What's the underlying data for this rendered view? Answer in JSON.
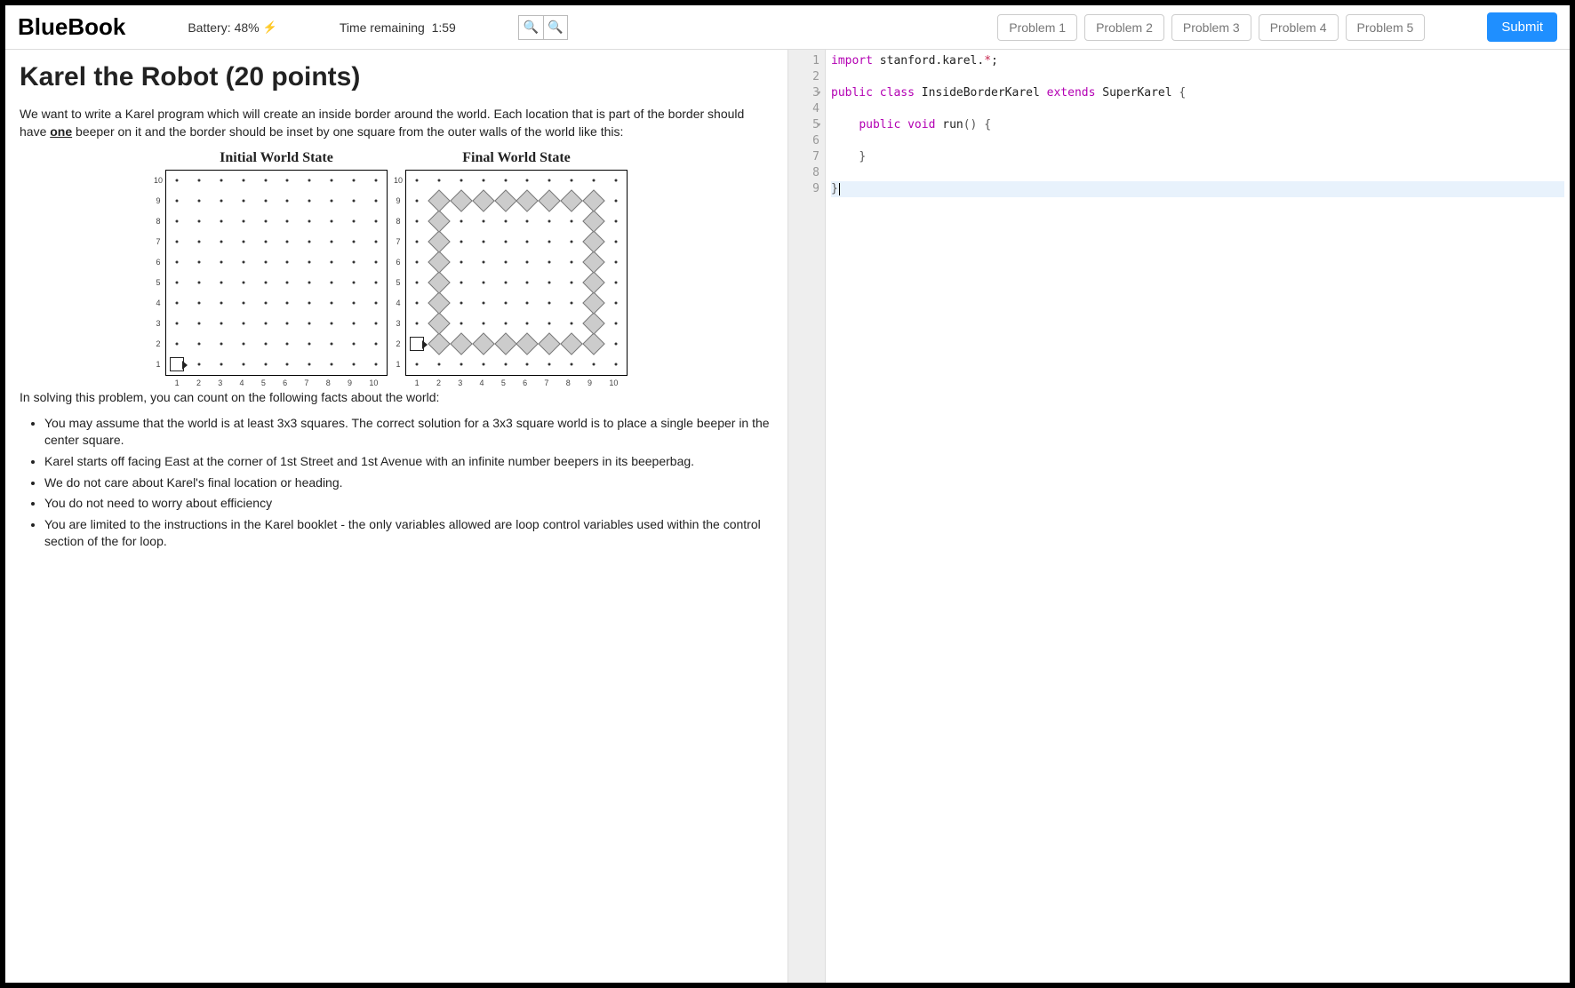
{
  "header": {
    "brand": "BlueBook",
    "battery_label": "Battery:",
    "battery_value": "48%",
    "time_label": "Time remaining",
    "time_value": "1:59",
    "problems": [
      "Problem 1",
      "Problem 2",
      "Problem 3",
      "Problem 4",
      "Problem 5"
    ],
    "submit": "Submit"
  },
  "problem": {
    "title": "Karel the Robot (20 points)",
    "intro_a": "We want to write a Karel program which will create an inside border around the world. Each location that is part of the border should have ",
    "intro_one": "one",
    "intro_b": " beeper on it and the border should be inset by one square from the outer walls of the world like this:",
    "initial_title": "Initial World State",
    "final_title": "Final World State",
    "facts_intro": "In solving this problem, you can count on the following facts about the world:",
    "facts": [
      "You may assume that the world is at least 3x3 squares. The correct solution for a 3x3 square world is to place a single beeper in the center square.",
      "Karel starts off facing East at the corner of 1st Street and 1st Avenue with an infinite number beepers in its beeperbag.",
      "We do not care about Karel's final location or heading.",
      "You do not need to worry about efficiency",
      "You are limited to the instructions in the Karel booklet - the only variables allowed are loop control variables used within the control section of the for loop."
    ],
    "grid": {
      "cols": 10,
      "rows": 10
    }
  },
  "editor": {
    "lines": [
      {
        "n": 1,
        "tokens": [
          [
            "key",
            "import"
          ],
          [
            "name",
            " stanford.karel."
          ],
          [
            "star",
            "*"
          ],
          [
            "name",
            ";"
          ]
        ]
      },
      {
        "n": 2,
        "tokens": []
      },
      {
        "n": 3,
        "fold": true,
        "tokens": [
          [
            "key",
            "public"
          ],
          [
            "name",
            " "
          ],
          [
            "key",
            "class"
          ],
          [
            "name",
            " InsideBorderKarel "
          ],
          [
            "key",
            "extends"
          ],
          [
            "name",
            " SuperKarel "
          ],
          [
            "brace",
            "{"
          ]
        ]
      },
      {
        "n": 4,
        "tokens": []
      },
      {
        "n": 5,
        "fold": true,
        "indent": 1,
        "tokens": [
          [
            "key",
            "public"
          ],
          [
            "name",
            " "
          ],
          [
            "key",
            "void"
          ],
          [
            "name",
            " run"
          ],
          [
            "brace",
            "()"
          ],
          [
            "name",
            " "
          ],
          [
            "brace",
            "{"
          ]
        ]
      },
      {
        "n": 6,
        "tokens": []
      },
      {
        "n": 7,
        "indent": 1,
        "tokens": [
          [
            "brace",
            "}"
          ]
        ]
      },
      {
        "n": 8,
        "tokens": []
      },
      {
        "n": 9,
        "active": true,
        "tokens": [
          [
            "brace",
            "}"
          ]
        ]
      }
    ]
  }
}
